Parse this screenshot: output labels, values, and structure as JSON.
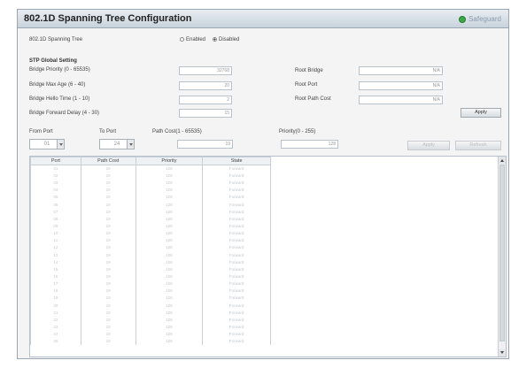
{
  "header": {
    "title": "802.1D Spanning Tree Configuration",
    "brand": "Safeguard"
  },
  "stp_toggle": {
    "label": "802.1D Spanning Tree",
    "enabled_label": "Enabled",
    "disabled_label": "Disabled",
    "selected": "Disabled"
  },
  "global": {
    "heading": "STP Global Setting",
    "bridge_priority_label": "Bridge Priority (0 - 65535)",
    "bridge_priority": "32768",
    "max_age_label": "Bridge Max Age (6 - 40)",
    "max_age": "20",
    "hello_time_label": "Bridge Hello Time (1 - 10)",
    "hello_time": "2",
    "forward_delay_label": "Bridge Forward  Delay (4 - 30)",
    "forward_delay": "15",
    "root_bridge_label": "Root Bridge",
    "root_bridge": "N/A",
    "root_port_label": "Root Port",
    "root_port": "N/A",
    "root_path_cost_label": "Root Path Cost",
    "root_path_cost": "N/A",
    "apply_label": "Apply"
  },
  "port_form": {
    "from_label": "From Port",
    "from_value": "01",
    "to_label": "To Port",
    "to_value": "24",
    "cost_label": "Path Cost(1 - 65535)",
    "cost_value": "19",
    "priority_label": "Priority(0 - 255)",
    "priority_value": "128",
    "apply_label": "Apply",
    "refresh_label": "Refresh"
  },
  "table": {
    "headers": [
      "Port",
      "Path Cost",
      "Priority",
      "State"
    ],
    "rows": [
      [
        "01",
        "19",
        "128",
        "Forward"
      ],
      [
        "02",
        "19",
        "128",
        "Forward"
      ],
      [
        "03",
        "19",
        "128",
        "Forward"
      ],
      [
        "04",
        "19",
        "128",
        "Forward"
      ],
      [
        "05",
        "19",
        "128",
        "Forward"
      ],
      [
        "06",
        "19",
        "128",
        "Forward"
      ],
      [
        "07",
        "19",
        "128",
        "Forward"
      ],
      [
        "08",
        "19",
        "128",
        "Forward"
      ],
      [
        "09",
        "19",
        "128",
        "Forward"
      ],
      [
        "10",
        "19",
        "128",
        "Forward"
      ],
      [
        "11",
        "19",
        "128",
        "Forward"
      ],
      [
        "12",
        "19",
        "128",
        "Forward"
      ],
      [
        "13",
        "19",
        "128",
        "Forward"
      ],
      [
        "14",
        "19",
        "128",
        "Forward"
      ],
      [
        "15",
        "19",
        "128",
        "Forward"
      ],
      [
        "16",
        "19",
        "128",
        "Forward"
      ],
      [
        "17",
        "19",
        "128",
        "Forward"
      ],
      [
        "18",
        "19",
        "128",
        "Forward"
      ],
      [
        "19",
        "19",
        "128",
        "Forward"
      ],
      [
        "20",
        "19",
        "128",
        "Forward"
      ],
      [
        "21",
        "19",
        "128",
        "Forward"
      ],
      [
        "22",
        "19",
        "128",
        "Forward"
      ],
      [
        "23",
        "19",
        "128",
        "Forward"
      ],
      [
        "24",
        "19",
        "128",
        "Forward"
      ],
      [
        "25",
        "19",
        "128",
        "Forward"
      ]
    ]
  }
}
